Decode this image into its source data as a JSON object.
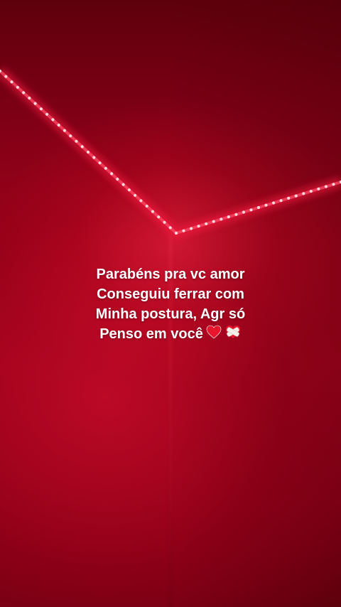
{
  "story": {
    "caption_lines": [
      "Parabéns pra vc amor",
      "Conseguiu ferrar com",
      "Minha postura, Agr só",
      "Penso em você"
    ],
    "emojis": [
      "red-heart-icon",
      "mending-heart-icon"
    ]
  },
  "colors": {
    "background": "#9a0219",
    "led": "#ffd6dc",
    "led_glow": "#ff2046",
    "text": "#ffffff"
  }
}
